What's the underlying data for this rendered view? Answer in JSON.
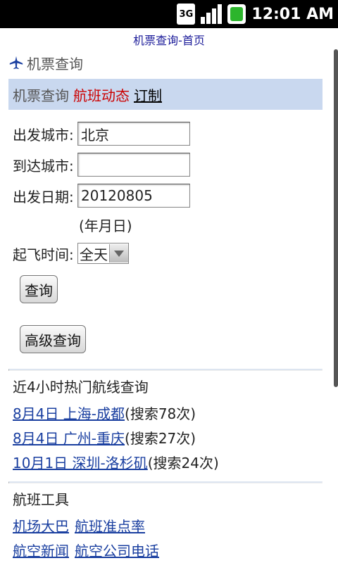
{
  "status_bar": {
    "network": "3G",
    "time": "12:01 AM"
  },
  "page_title": "机票查询-首页",
  "header": {
    "logo_text": "机票查询"
  },
  "nav": {
    "current": "机票查询",
    "flight_status": "航班动态",
    "customize": "订制"
  },
  "form": {
    "departure_label": "出发城市:",
    "departure_value": "北京",
    "arrival_label": "到达城市:",
    "arrival_value": "",
    "date_label": "出发日期:",
    "date_value": "20120805",
    "date_hint": "(年月日)",
    "time_label": "起飞时间:",
    "time_value": "全天",
    "search_button": "查询",
    "advanced_button": "高级查询"
  },
  "hot_routes": {
    "heading": "近4小时热门航线查询",
    "items": [
      {
        "link": "8月4日 上海-成都",
        "count": "(搜索78次)"
      },
      {
        "link": "8月4日 广州-重庆",
        "count": "(搜索27次)"
      },
      {
        "link": "10月1日 深圳-洛杉矶",
        "count": "(搜索24次)"
      }
    ]
  },
  "tools": {
    "heading": "航班工具",
    "row1": [
      "机场大巴",
      "航班准点率"
    ],
    "row2": [
      "航空新闻",
      "航空公司电话"
    ]
  },
  "icons": {
    "plane": "airplane-icon",
    "signal": "signal-icon",
    "battery": "battery-icon"
  },
  "colors": {
    "nav_bg": "#c9d8ef",
    "link": "#1a3fa0",
    "red": "#cc0000"
  }
}
